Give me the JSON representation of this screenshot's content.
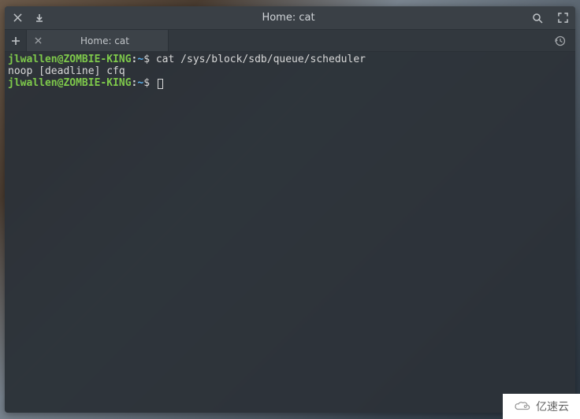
{
  "window": {
    "title": "Home: cat"
  },
  "tabs": [
    {
      "label": "Home: cat"
    }
  ],
  "terminal": {
    "prompt_user_host": "jlwallen@ZOMBIE-KING",
    "prompt_path": "~",
    "prompt_symbol": "$",
    "lines": [
      {
        "type": "command",
        "text": "cat /sys/block/sdb/queue/scheduler"
      },
      {
        "type": "output",
        "text": "noop [deadline] cfq"
      },
      {
        "type": "command",
        "text": "",
        "cursor": true
      }
    ]
  },
  "watermark": {
    "text": "亿速云"
  }
}
